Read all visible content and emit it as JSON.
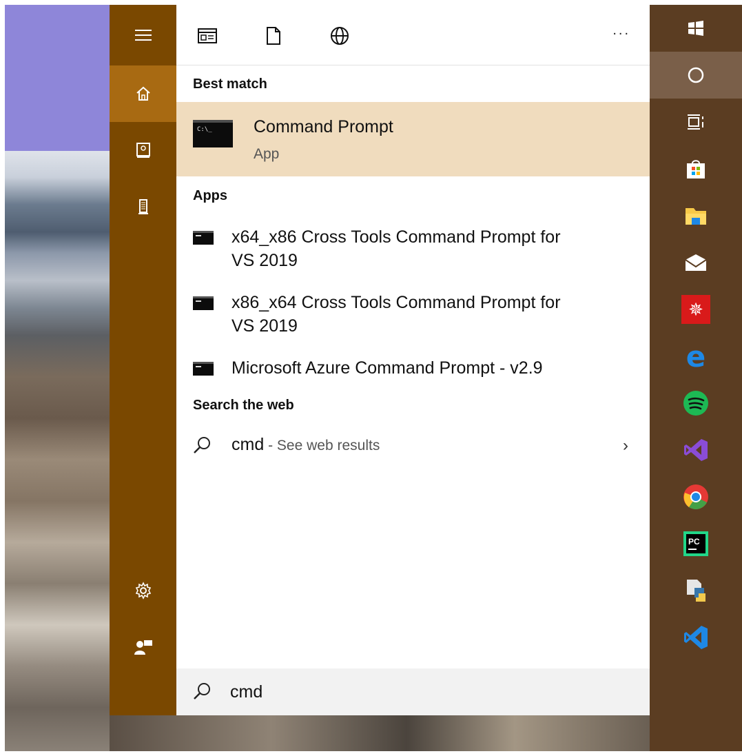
{
  "rail": {
    "items": [
      {
        "name": "hamburger-menu-icon",
        "glyph": "≡"
      },
      {
        "name": "home-icon",
        "glyph": "⌂"
      },
      {
        "name": "my-stuff-icon",
        "glyph": "▣"
      },
      {
        "name": "tower-icon",
        "glyph": "▮"
      }
    ],
    "bottom": [
      {
        "name": "settings-gear-icon",
        "glyph": "⚙"
      },
      {
        "name": "feedback-icon",
        "glyph": "✉"
      }
    ]
  },
  "toolbar": {
    "filters": [
      "apps-filter-icon",
      "documents-filter-icon",
      "web-filter-icon"
    ],
    "more_label": "..."
  },
  "results": {
    "best_match_label": "Best match",
    "best_match": {
      "title": "Command Prompt",
      "subtitle": "App"
    },
    "apps_label": "Apps",
    "apps": [
      {
        "line1": "x64_x86 Cross Tools Command Prompt for",
        "line2": "VS 2019"
      },
      {
        "line1": "x86_x64 Cross Tools Command Prompt for",
        "line2": "VS 2019"
      },
      {
        "line1": "Microsoft Azure Command Prompt - v2.9",
        "line2": ""
      }
    ],
    "web_label": "Search the web",
    "web": {
      "query": "cmd",
      "separator": " - ",
      "hint": "See web results"
    }
  },
  "search": {
    "value": "cmd"
  },
  "taskbar": {
    "icons": [
      {
        "name": "windows-start-icon",
        "color": "#ffffff"
      },
      {
        "name": "cortana-icon",
        "color": "#ffffff"
      },
      {
        "name": "task-view-icon",
        "color": "#ffffff"
      },
      {
        "name": "microsoft-store-icon",
        "color": "#ffffff"
      },
      {
        "name": "file-explorer-icon",
        "color": "#f7c948"
      },
      {
        "name": "mail-icon",
        "color": "#ffffff"
      },
      {
        "name": "wolfram-icon",
        "color": "#d91a1a"
      },
      {
        "name": "edge-icon",
        "color": "#1e88e5"
      },
      {
        "name": "spotify-icon",
        "color": "#1db954"
      },
      {
        "name": "visual-studio-icon",
        "color": "#8a4cd6"
      },
      {
        "name": "chrome-icon",
        "color": "#e53935"
      },
      {
        "name": "pycharm-icon",
        "color": "#21d789"
      },
      {
        "name": "python-file-icon",
        "color": "#f2c94c"
      },
      {
        "name": "vscode-icon",
        "color": "#1e88e5"
      }
    ]
  },
  "colors": {
    "rail": "#7a4800",
    "rail_active": "#a86a12",
    "best_match_bg": "#f0dcbe",
    "taskbar": "#5b3d22"
  }
}
